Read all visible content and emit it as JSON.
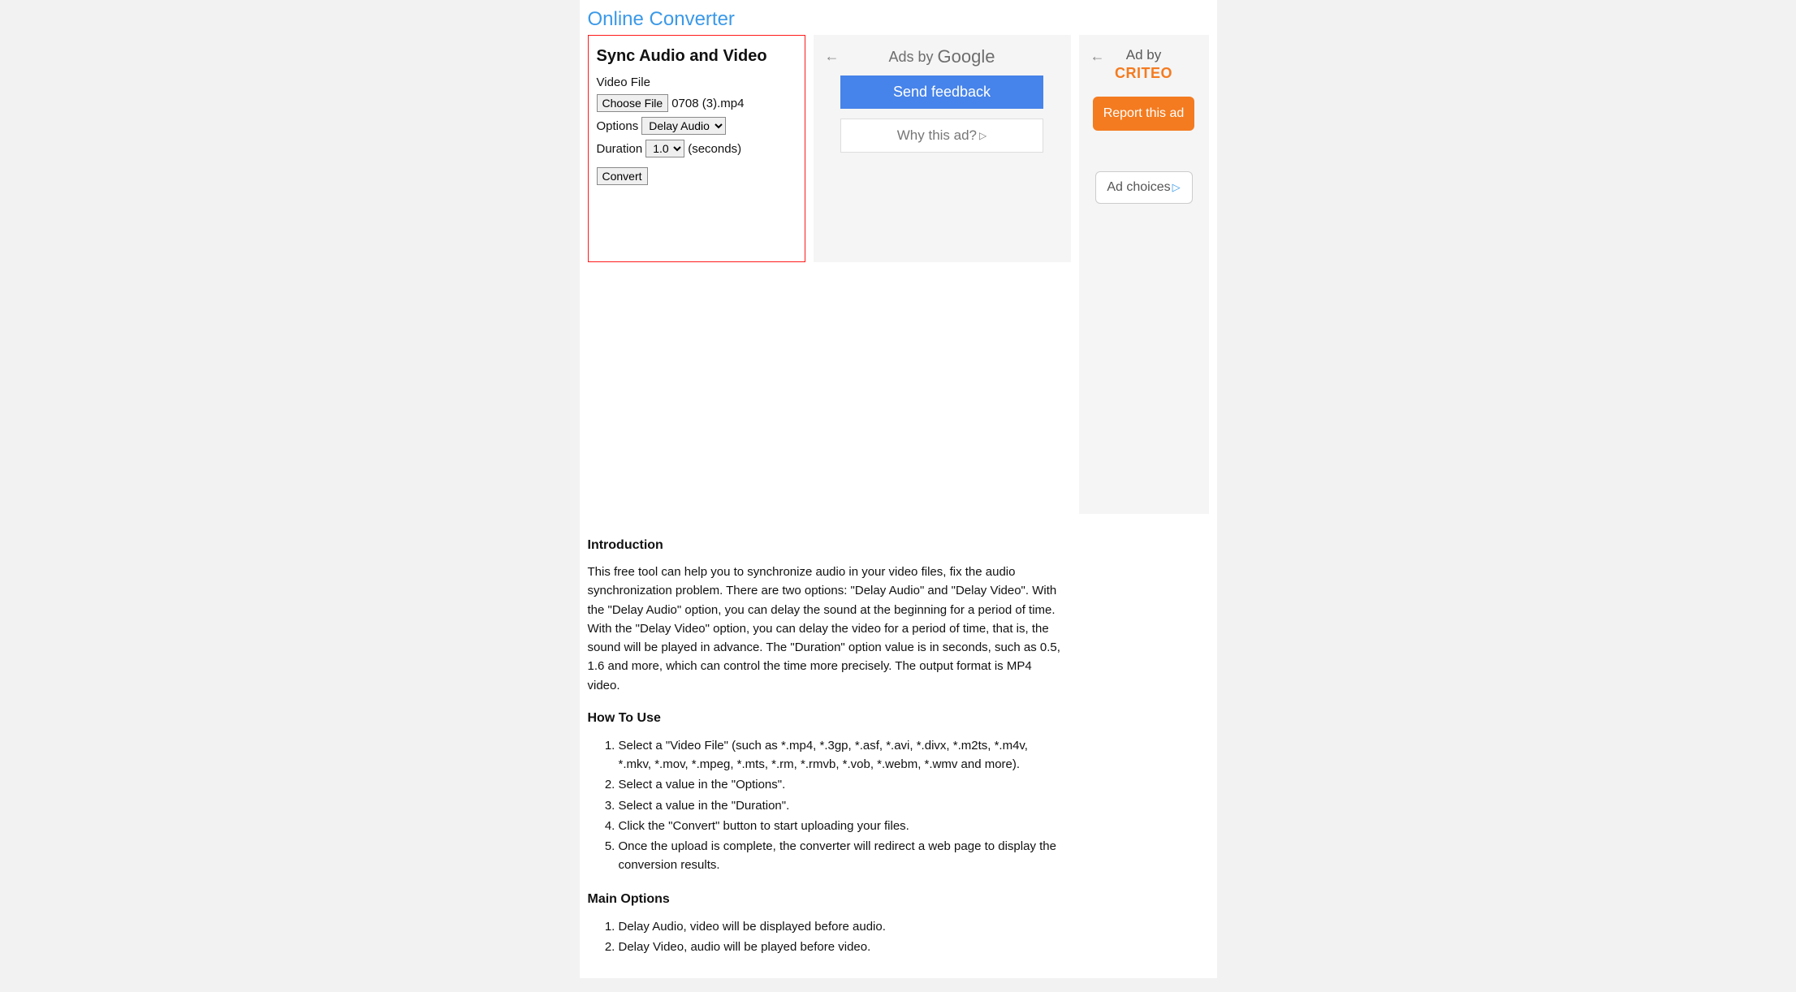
{
  "site": {
    "title": "Online Converter"
  },
  "tool": {
    "title": "Sync Audio and Video",
    "file_label": "Video File",
    "choose_file_btn": "Choose File",
    "chosen_file_name": "0708 (3).mp4",
    "options_label": "Options",
    "options_selected": "Delay Audio",
    "duration_label": "Duration",
    "duration_selected": "1.0",
    "duration_unit": "(seconds)",
    "convert_btn": "Convert"
  },
  "ad_google": {
    "back_arrow": "←",
    "head_prefix": "Ads by ",
    "head_brand": "Google",
    "send_feedback": "Send feedback",
    "why_this_ad": "Why this ad?"
  },
  "ad_criteo": {
    "back_arrow": "←",
    "head_txt": "Ad by",
    "brand": "CRITEO",
    "report_btn": "Report this ad",
    "ad_choices": "Ad choices"
  },
  "content": {
    "intro_heading": "Introduction",
    "intro_body": "This free tool can help you to synchronize audio in your video files, fix the audio synchronization problem. There are two options: \"Delay Audio\" and \"Delay Video\". With the \"Delay Audio\" option, you can delay the sound at the beginning for a period of time. With the \"Delay Video\" option, you can delay the video for a period of time, that is, the sound will be played in advance. The \"Duration\" option value is in seconds, such as 0.5, 1.6 and more, which can control the time more precisely. The output format is MP4 video.",
    "howto_heading": "How To Use",
    "howto_steps": [
      "Select a \"Video File\" (such as *.mp4, *.3gp, *.asf, *.avi, *.divx, *.m2ts, *.m4v, *.mkv, *.mov, *.mpeg, *.mts, *.rm, *.rmvb, *.vob, *.webm, *.wmv and more).",
      "Select a value in the \"Options\".",
      "Select a value in the \"Duration\".",
      "Click the \"Convert\" button to start uploading your files.",
      "Once the upload is complete, the converter will redirect a web page to display the conversion results."
    ],
    "main_options_heading": "Main Options",
    "main_options": [
      "Delay Audio, video will be displayed before audio.",
      "Delay Video, audio will be played before video."
    ]
  }
}
